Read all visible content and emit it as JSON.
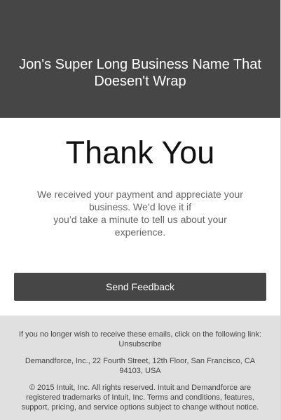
{
  "header": {
    "business_name": "Jon's Super Long Business Name That Doesen't Wrap"
  },
  "main": {
    "heading": "Thank You",
    "message_lines": [
      "We received your payment and appreciate your",
      "business. We’d love it if",
      "you’d take a minute to tell us about your",
      "experience."
    ],
    "feedback_button_label": "Send Feedback"
  },
  "footer": {
    "unsubscribe_text": "If you no longer wish to receive these emails, click on the following link:",
    "unsubscribe_link": "Unsubscribe",
    "address_lines": [
      "Demandforce, Inc., 22 Fourth Street, 12th Floor, San Francisco, CA",
      "94103, USA"
    ],
    "legal_lines": [
      "© 2015 Intuit, Inc. All rights reserved. Intuit and Demandforce are",
      "registered trademarks of Intuit, Inc. Terms and conditions, features,",
      "support, pricing, and service options subject to change without notice."
    ]
  },
  "colors": {
    "header_bg": "#464646",
    "button_bg": "#464646",
    "footer_bg": "#e0e0e0",
    "body_text": "#666666"
  }
}
